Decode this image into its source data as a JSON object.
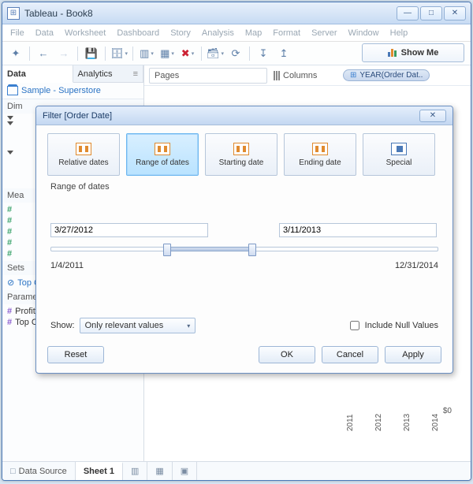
{
  "window": {
    "title": "Tableau - Book8"
  },
  "menubar": [
    "File",
    "Data",
    "Worksheet",
    "Dashboard",
    "Story",
    "Analysis",
    "Map",
    "Format",
    "Server",
    "Window",
    "Help"
  ],
  "showme": "Show Me",
  "panel": {
    "tabs": {
      "data": "Data",
      "analytics": "Analytics"
    },
    "datasource": "Sample - Superstore",
    "dimensions_label": "Dim",
    "measures_label": "Mea",
    "sets_label": "Sets",
    "parameters_label": "Parameters",
    "sets_item": "Top Customers by Profit",
    "params": [
      "Profit Bin Size",
      "Top Customers"
    ]
  },
  "shelves": {
    "pages": "Pages",
    "columns": "Columns",
    "pill": "YEAR(Order Dat.."
  },
  "chart": {
    "zero": "$0",
    "years": [
      "2011",
      "2012",
      "2013",
      "2014"
    ]
  },
  "bottom": {
    "datasource": "Data Source",
    "sheet": "Sheet 1"
  },
  "modal": {
    "title": "Filter [Order Date]",
    "tabs": {
      "relative": "Relative dates",
      "range": "Range of dates",
      "starting": "Starting date",
      "ending": "Ending date",
      "special": "Special"
    },
    "subhead": "Range of dates",
    "start_date": "3/27/2012",
    "end_date": "3/11/2013",
    "range_min": "1/4/2011",
    "range_max": "12/31/2014",
    "show_label": "Show:",
    "show_value": "Only relevant values",
    "include_null": "Include Null Values",
    "buttons": {
      "reset": "Reset",
      "ok": "OK",
      "cancel": "Cancel",
      "apply": "Apply"
    }
  }
}
